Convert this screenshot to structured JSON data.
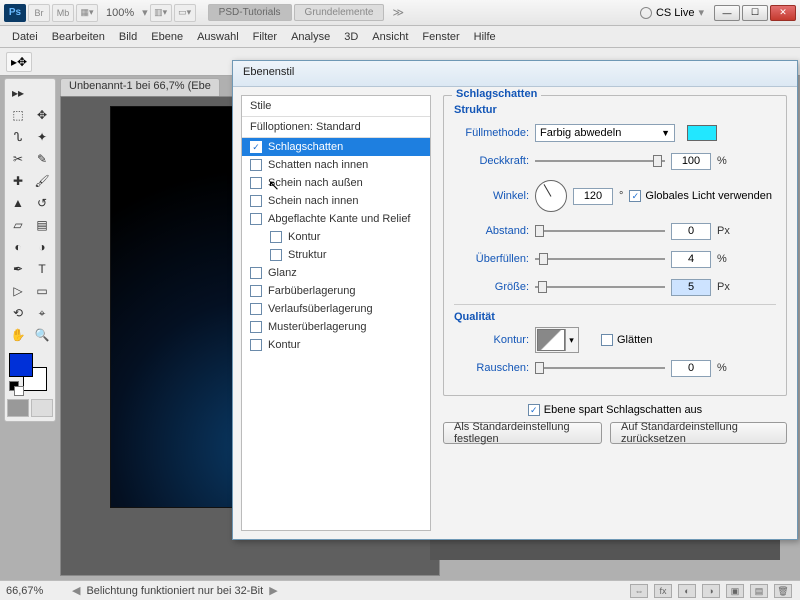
{
  "topbar": {
    "zoom": "100%",
    "pill1": "PSD-Tutorials",
    "pill2": "Grundelemente",
    "cslive": "CS Live"
  },
  "menu": [
    "Datei",
    "Bearbeiten",
    "Bild",
    "Ebene",
    "Auswahl",
    "Filter",
    "Analyse",
    "3D",
    "Ansicht",
    "Fenster",
    "Hilfe"
  ],
  "doc_tab": "Unbenannt-1 bei 66,7% (Ebe",
  "status": {
    "pct": "66,67%",
    "msg": "Belichtung funktioniert nur bei 32-Bit"
  },
  "dialog": {
    "title": "Ebenenstil",
    "styles_header": "Stile",
    "fill_opts": "Fülloptionen: Standard",
    "styles": [
      {
        "label": "Schlagschatten",
        "checked": true,
        "selected": true
      },
      {
        "label": "Schatten nach innen",
        "checked": false
      },
      {
        "label": "Schein nach außen",
        "checked": false
      },
      {
        "label": "Schein nach innen",
        "checked": false
      },
      {
        "label": "Abgeflachte Kante und Relief",
        "checked": false
      },
      {
        "label": "Kontur",
        "checked": false,
        "indent": true
      },
      {
        "label": "Struktur",
        "checked": false,
        "indent": true
      },
      {
        "label": "Glanz",
        "checked": false
      },
      {
        "label": "Farbüberlagerung",
        "checked": false
      },
      {
        "label": "Verlaufsüberlagerung",
        "checked": false
      },
      {
        "label": "Musterüberlagerung",
        "checked": false
      },
      {
        "label": "Kontur",
        "checked": false
      }
    ],
    "section_title": "Schlagschatten",
    "struktur": "Struktur",
    "qualitaet": "Qualität",
    "labels": {
      "fuellmethode": "Füllmethode:",
      "deckkraft": "Deckkraft:",
      "winkel": "Winkel:",
      "global": "Globales Licht verwenden",
      "abstand": "Abstand:",
      "ueberfuellen": "Überfüllen:",
      "groesse": "Größe:",
      "kontur": "Kontur:",
      "glaetten": "Glätten",
      "rauschen": "Rauschen:"
    },
    "values": {
      "fuellmethode": "Farbig abwedeln",
      "deckkraft": "100",
      "winkel": "120",
      "abstand": "0",
      "ueberfuellen": "4",
      "groesse": "5",
      "rauschen": "0"
    },
    "units": {
      "pct": "%",
      "deg": "°",
      "px": "Px"
    },
    "ebene_spart": "Ebene spart Schlagschatten aus",
    "btn_std": "Als Standardeinstellung festlegen",
    "btn_reset": "Auf Standardeinstellung zurücksetzen"
  }
}
